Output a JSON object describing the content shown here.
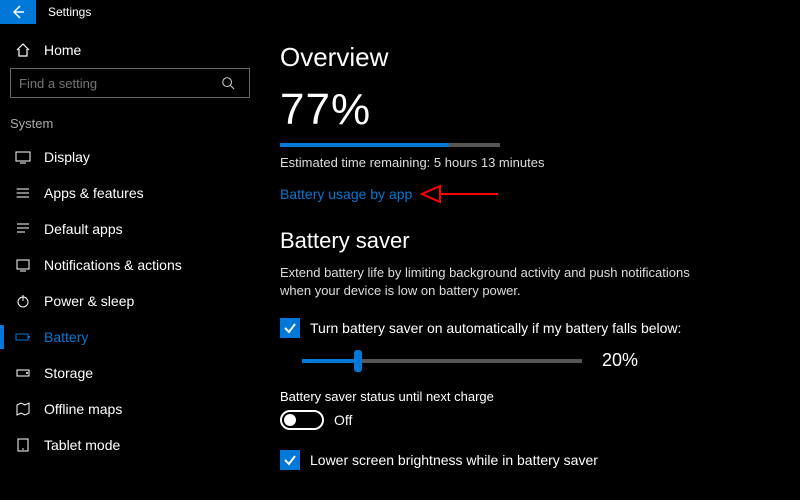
{
  "titlebar": {
    "title": "Settings"
  },
  "sidebar": {
    "home": "Home",
    "search_placeholder": "Find a setting",
    "section": "System",
    "items": [
      {
        "label": "Display"
      },
      {
        "label": "Apps & features"
      },
      {
        "label": "Default apps"
      },
      {
        "label": "Notifications & actions"
      },
      {
        "label": "Power & sleep"
      },
      {
        "label": "Battery"
      },
      {
        "label": "Storage"
      },
      {
        "label": "Offline maps"
      },
      {
        "label": "Tablet mode"
      }
    ],
    "active_index": 5
  },
  "main": {
    "overview_heading": "Overview",
    "percent_label": "77%",
    "percent": 77,
    "estimate": "Estimated time remaining: 5 hours 13 minutes",
    "usage_link": "Battery usage by app",
    "saver_heading": "Battery saver",
    "saver_desc": "Extend battery life by limiting background activity and push notifications when your device is low on battery power.",
    "auto_on_label": "Turn battery saver on automatically if my battery falls below:",
    "auto_on_checked": true,
    "threshold_percent": 20,
    "threshold_label": "20%",
    "status_label": "Battery saver status until next charge",
    "toggle_state": "Off",
    "lower_brightness_label": "Lower screen brightness while in battery saver",
    "lower_brightness_checked": true
  },
  "colors": {
    "accent": "#0078d7"
  }
}
